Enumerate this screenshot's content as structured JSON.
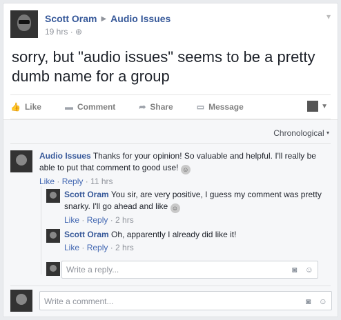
{
  "post": {
    "author": "Scott Oram",
    "group": "Audio Issues",
    "time": "19 hrs",
    "privacy_icon": "globe-icon",
    "text": "sorry, but \"audio issues\" seems to be a pretty dumb name for a group"
  },
  "actions": {
    "like": "Like",
    "comment": "Comment",
    "share": "Share",
    "message": "Message"
  },
  "comments": {
    "sort_label": "Chronological",
    "list": [
      {
        "author": "Audio Issues",
        "text": "Thanks for your opinion! So valuable and helpful. I'll really be able to put that comment to good use!",
        "like": "Like",
        "reply": "Reply",
        "time": "11 hrs"
      }
    ],
    "replies": [
      {
        "author": "Scott Oram",
        "text": "You sir, are very positive, I guess my comment was pretty snarky. I'll go ahead and like",
        "like": "Like",
        "reply": "Reply",
        "time": "2 hrs"
      },
      {
        "author": "Scott Oram",
        "text": "Oh, apparently I already did like it!",
        "like": "Like",
        "reply": "Reply",
        "time": "2 hrs"
      }
    ],
    "reply_placeholder": "Write a reply...",
    "comment_placeholder": "Write a comment..."
  }
}
